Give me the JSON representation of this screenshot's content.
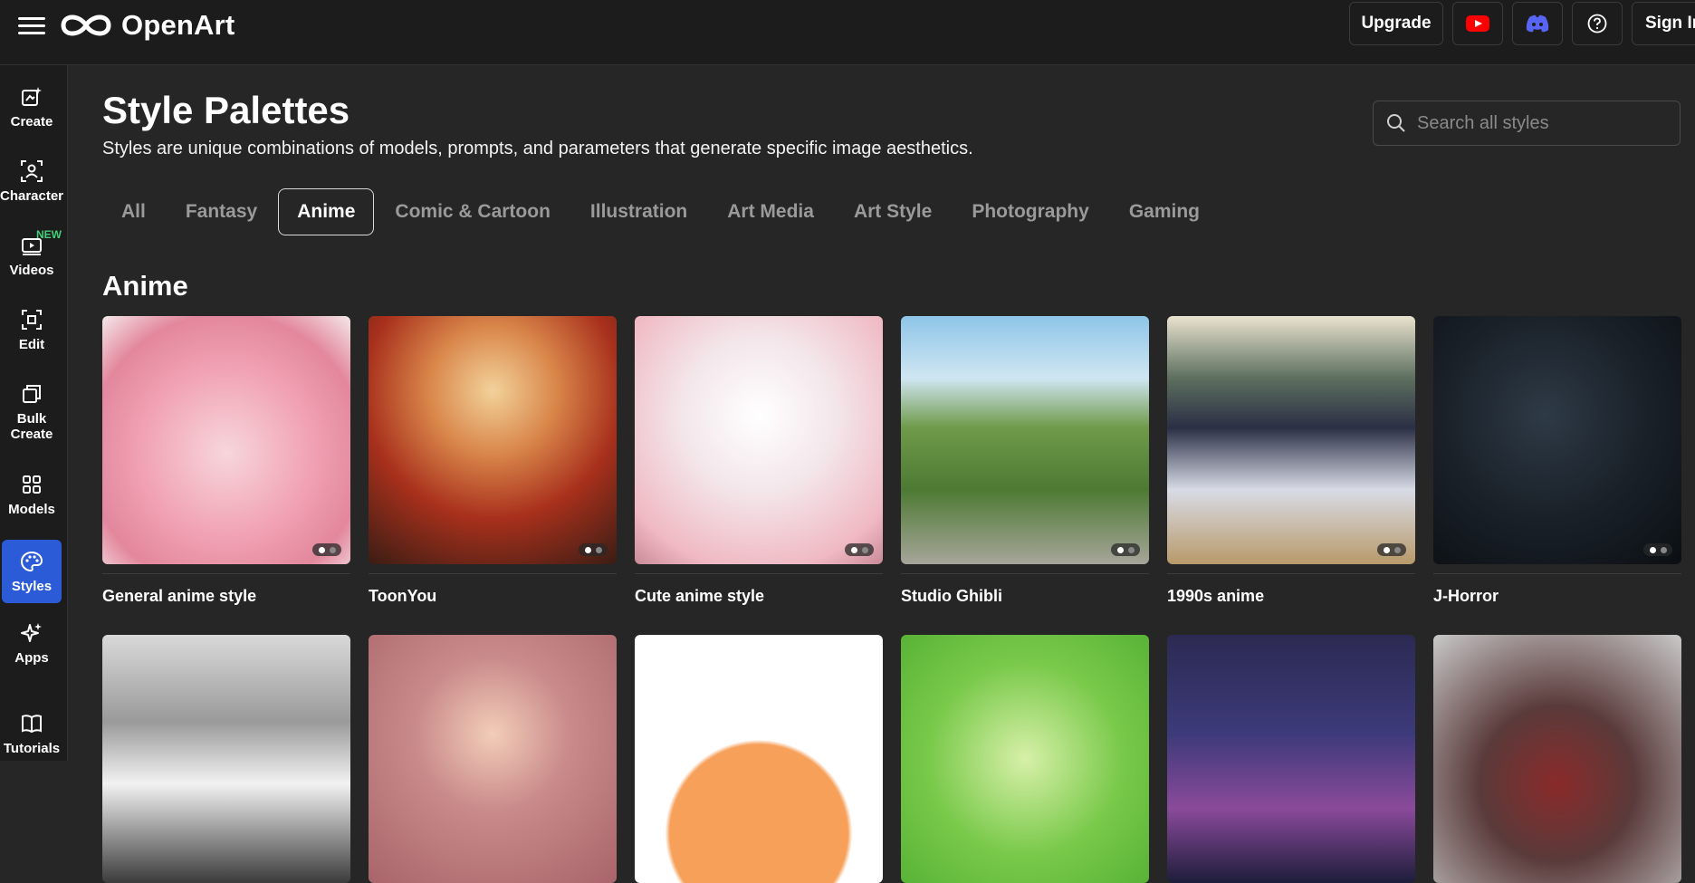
{
  "brand": {
    "name": "OpenArt"
  },
  "topbar": {
    "upgrade_label": "Upgrade",
    "youtube_icon": "youtube-icon",
    "discord_icon": "discord-icon",
    "help_icon": "help-icon",
    "signin_label": "Sign In"
  },
  "sidebar": {
    "items": [
      {
        "label": "Create",
        "icon": "create-icon"
      },
      {
        "label": "Character",
        "icon": "character-icon"
      },
      {
        "label": "Videos",
        "icon": "video-icon",
        "badge": "NEW"
      },
      {
        "label": "Edit",
        "icon": "edit-icon"
      },
      {
        "label": "Bulk Create",
        "icon": "bulk-create-icon"
      },
      {
        "label": "Models",
        "icon": "models-icon"
      },
      {
        "label": "Styles",
        "icon": "palette-icon",
        "active": true
      },
      {
        "label": "Apps",
        "icon": "sparkle-icon"
      },
      {
        "label": "Tutorials",
        "icon": "book-icon"
      }
    ]
  },
  "main": {
    "title": "Style Palettes",
    "subtitle": "Styles are unique combinations of models, prompts, and parameters that generate specific image aesthetics.",
    "search_placeholder": "Search all styles",
    "tabs": [
      "All",
      "Fantasy",
      "Anime",
      "Comic & Cartoon",
      "Illustration",
      "Art Media",
      "Art Style",
      "Photography",
      "Gaming"
    ],
    "active_tab": "Anime",
    "section_title": "Anime",
    "cards_row1": [
      {
        "name": "General anime style"
      },
      {
        "name": "ToonYou"
      },
      {
        "name": "Cute anime style"
      },
      {
        "name": "Studio Ghibli"
      },
      {
        "name": "1990s anime"
      },
      {
        "name": "J-Horror"
      }
    ]
  },
  "colors": {
    "background": "#262626",
    "panel": "#1c1c1c",
    "accent": "#2b5bd7",
    "new_badge": "#43d17a"
  }
}
